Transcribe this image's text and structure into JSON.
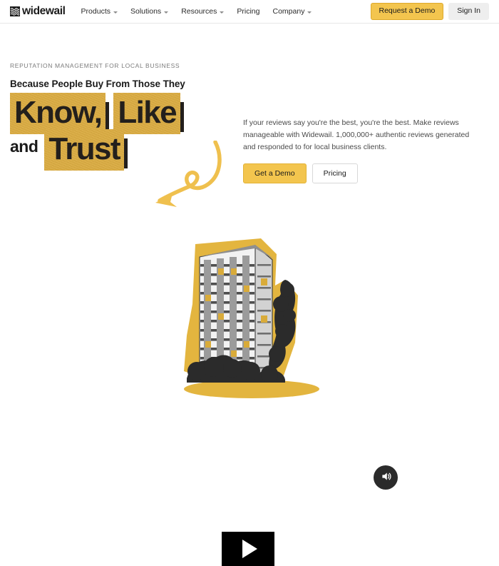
{
  "brand": {
    "name": "widewail",
    "mark_icon": "widewail-logo-icon"
  },
  "nav": {
    "items": [
      {
        "label": "Products",
        "has_caret": true
      },
      {
        "label": "Solutions",
        "has_caret": true
      },
      {
        "label": "Resources",
        "has_caret": true
      },
      {
        "label": "Pricing",
        "has_caret": false
      },
      {
        "label": "Company",
        "has_caret": true
      }
    ],
    "request_demo_label": "Request a Demo",
    "sign_in_label": "Sign In"
  },
  "hero": {
    "eyebrow": "REPUTATION MANAGEMENT FOR LOCAL BUSINESS",
    "subhead": "Because People Buy From Those They",
    "highlight_1": "Know,",
    "highlight_2": "Like",
    "connector": "and",
    "highlight_3": "Trust",
    "copy": "If your reviews say you're the best, you're the best. Make reviews manageable with Widewail. 1,000,000+ authentic reviews generated and responded to for local business clients.",
    "cta_primary": "Get a Demo",
    "cta_secondary": "Pricing"
  },
  "video": {
    "play_icon": "play-icon",
    "sound_icon": "speaker-on-icon",
    "image_alt": "high-rise apartment building cutout"
  },
  "colors": {
    "accent_yellow": "#DFAE3E",
    "button_yellow": "#F3C54E",
    "ink": "#231F1C",
    "muted_text": "#7B7B7B"
  }
}
